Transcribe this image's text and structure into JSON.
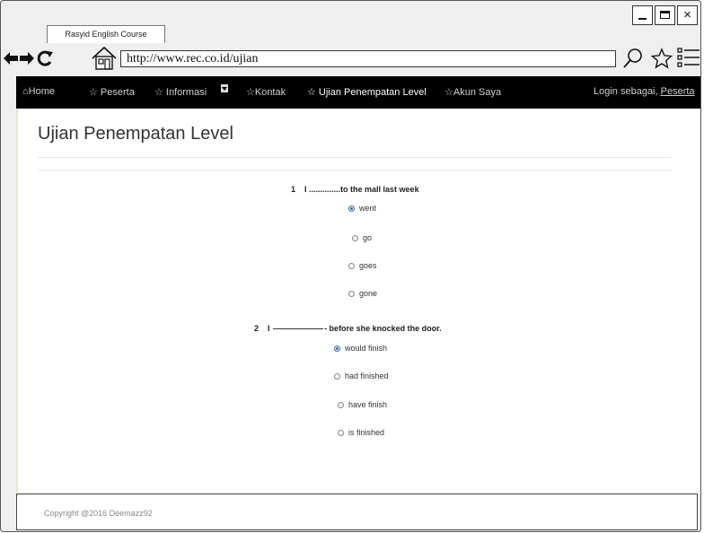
{
  "browser": {
    "tab_title": "Rasyid English Course",
    "url": "http://www.rec.co.id/ujian",
    "close_glyph": "×"
  },
  "nav": {
    "home": "⌂Home",
    "peserta": "☆ Peserta",
    "informasi": "☆ Informasi",
    "kontak": "☆Kontak",
    "ujian": "☆ Ujian Penempatan Level",
    "akun": "☆Akun Saya",
    "login_prefix": "Login sebagai, ",
    "login_user": "Peserta"
  },
  "page": {
    "title": "Ujian Penempatan Level"
  },
  "questions": [
    {
      "number": "1",
      "text": "I ..............to the mall last week",
      "options": [
        "went",
        "go",
        "goes",
        "gone"
      ],
      "selected": 0
    },
    {
      "number": "2",
      "text_before": "I",
      "text_after": "- before she knocked the door.",
      "options": [
        "would finish",
        "had finished",
        "have finish",
        "is finished"
      ],
      "selected": 0
    }
  ],
  "footer": {
    "copyright": "Copyright @2016 Deemazz92"
  }
}
